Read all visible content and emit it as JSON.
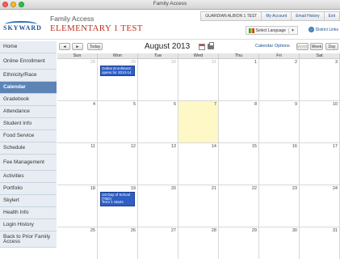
{
  "window": {
    "title": "Family Access"
  },
  "header": {
    "logo_text": "SKYWARD",
    "app_name": "Family Access",
    "school_name": "ELEMENTARY 1 TEST",
    "nav": [
      "GUARDIAN ALBION 1 TEST",
      "My Account",
      "Email History",
      "Exit"
    ],
    "language_label": "Select Language",
    "district_links": "District Links"
  },
  "sidebar": {
    "items": [
      {
        "label": "Home"
      },
      {
        "label": "Online Enrollment"
      },
      {
        "label": "Ethnicity/Race"
      },
      {
        "label": "Calendar",
        "active": true
      },
      {
        "label": "Gradebook"
      },
      {
        "label": "Attendance"
      },
      {
        "label": "Student Info"
      },
      {
        "label": "Food Service"
      },
      {
        "label": "Schedule"
      },
      {
        "label": "Fee Management"
      },
      {
        "label": "Activities"
      },
      {
        "label": "Portfolio"
      },
      {
        "label": "Skylert"
      },
      {
        "label": "Health Info"
      },
      {
        "label": "Login History"
      },
      {
        "label": "Back to Prior Family Access"
      }
    ]
  },
  "calendar": {
    "prev_label": "◄",
    "next_label": "►",
    "today_label": "Today",
    "month_title": "August 2013",
    "options_label": "Calendar Options",
    "views": [
      "Month",
      "Week",
      "Day"
    ],
    "days_of_week": [
      "Sun",
      "Mon",
      "Tue",
      "Wed",
      "Thu",
      "Fri",
      "Sat"
    ],
    "weeks": [
      [
        {
          "n": "28",
          "other": true
        },
        {
          "n": "29",
          "other": true
        },
        {
          "n": "30",
          "other": true
        },
        {
          "n": "31",
          "other": true
        },
        {
          "n": "1"
        },
        {
          "n": "2"
        },
        {
          "n": "3"
        }
      ],
      [
        {
          "n": "4"
        },
        {
          "n": "5"
        },
        {
          "n": "6"
        },
        {
          "n": "7",
          "today": true
        },
        {
          "n": "8"
        },
        {
          "n": "9"
        },
        {
          "n": "10"
        }
      ],
      [
        {
          "n": "11"
        },
        {
          "n": "12"
        },
        {
          "n": "13"
        },
        {
          "n": "14"
        },
        {
          "n": "15"
        },
        {
          "n": "16"
        },
        {
          "n": "17"
        }
      ],
      [
        {
          "n": "18"
        },
        {
          "n": "19"
        },
        {
          "n": "20"
        },
        {
          "n": "21"
        },
        {
          "n": "22"
        },
        {
          "n": "23"
        },
        {
          "n": "24"
        }
      ],
      [
        {
          "n": "25"
        },
        {
          "n": "26"
        },
        {
          "n": "27"
        },
        {
          "n": "28"
        },
        {
          "n": "29"
        },
        {
          "n": "30"
        },
        {
          "n": "31"
        }
      ]
    ],
    "events": [
      {
        "week": 0,
        "day": 1,
        "lines": [
          "Online Enrollment",
          "opens for 2013-14"
        ]
      },
      {
        "week": 3,
        "day": 1,
        "lines": [
          "1st Day of School (TBD)",
          "Term 1 Starts"
        ]
      }
    ]
  },
  "colors": {
    "accent": "#5d84b5",
    "event": "#2f5fc4",
    "today": "#fdf8c5",
    "school_name": "#c0301f"
  }
}
